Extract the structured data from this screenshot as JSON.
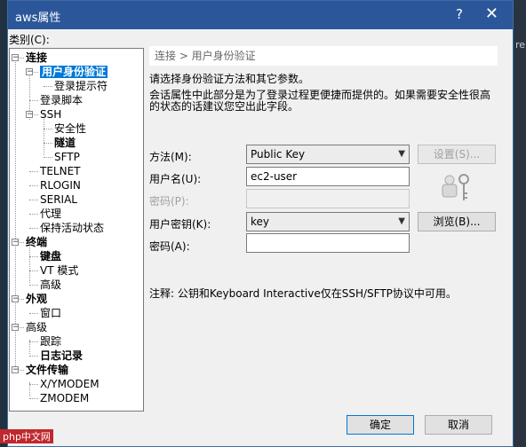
{
  "window": {
    "title": "aws属性",
    "help_glyph": "?",
    "close_glyph": "✕"
  },
  "category_label": "类别(C):",
  "tree": [
    {
      "label": "连接",
      "level": 0,
      "bold": true,
      "expander": "−"
    },
    {
      "label": "用户身份验证",
      "level": 1,
      "bold": true,
      "expander": "−",
      "selected": true
    },
    {
      "label": "登录提示符",
      "level": 2
    },
    {
      "label": "登录脚本",
      "level": 1
    },
    {
      "label": "SSH",
      "level": 1,
      "expander": "−"
    },
    {
      "label": "安全性",
      "level": 2
    },
    {
      "label": "隧道",
      "level": 2,
      "bold": true
    },
    {
      "label": "SFTP",
      "level": 2
    },
    {
      "label": "TELNET",
      "level": 1
    },
    {
      "label": "RLOGIN",
      "level": 1
    },
    {
      "label": "SERIAL",
      "level": 1
    },
    {
      "label": "代理",
      "level": 1
    },
    {
      "label": "保持活动状态",
      "level": 1
    },
    {
      "label": "终端",
      "level": 0,
      "bold": true,
      "expander": "−"
    },
    {
      "label": "键盘",
      "level": 1,
      "bold": true
    },
    {
      "label": "VT 模式",
      "level": 1
    },
    {
      "label": "高级",
      "level": 1
    },
    {
      "label": "外观",
      "level": 0,
      "bold": true,
      "expander": "−"
    },
    {
      "label": "窗口",
      "level": 1
    },
    {
      "label": "高级",
      "level": 0,
      "expander": "−"
    },
    {
      "label": "跟踪",
      "level": 1
    },
    {
      "label": "日志记录",
      "level": 1,
      "bold": true
    },
    {
      "label": "文件传输",
      "level": 0,
      "bold": true,
      "expander": "−"
    },
    {
      "label": "X/YMODEM",
      "level": 1
    },
    {
      "label": "ZMODEM",
      "level": 1
    }
  ],
  "panel": {
    "breadcrumb": "连接 > 用户身份验证",
    "intro": "请选择身份验证方法和其它参数。",
    "info_line1": "会话属性中此部分是为了登录过程更便捷而提供的。如果需要安全性很高",
    "info_line2": "的状态的话建议您空出此字段。",
    "method_label": "方法(M):",
    "method_value": "Public Key",
    "settings_button": "设置(S)...",
    "username_label": "用户名(U):",
    "username_value": "ec2-user",
    "password_label_disabled": "密码(P):",
    "user_key_label": "用户密钥(K):",
    "user_key_value": "key",
    "browse_button": "浏览(B)...",
    "passphrase_label": "密码(A):",
    "passphrase_value": "",
    "note": "注释: 公钥和Keyboard Interactive仅在SSH/SFTP协议中可用。"
  },
  "footer": {
    "ok_button": "确定",
    "cancel_button": "取消"
  },
  "desktop_right_text": "re",
  "watermark": "php中文网"
}
